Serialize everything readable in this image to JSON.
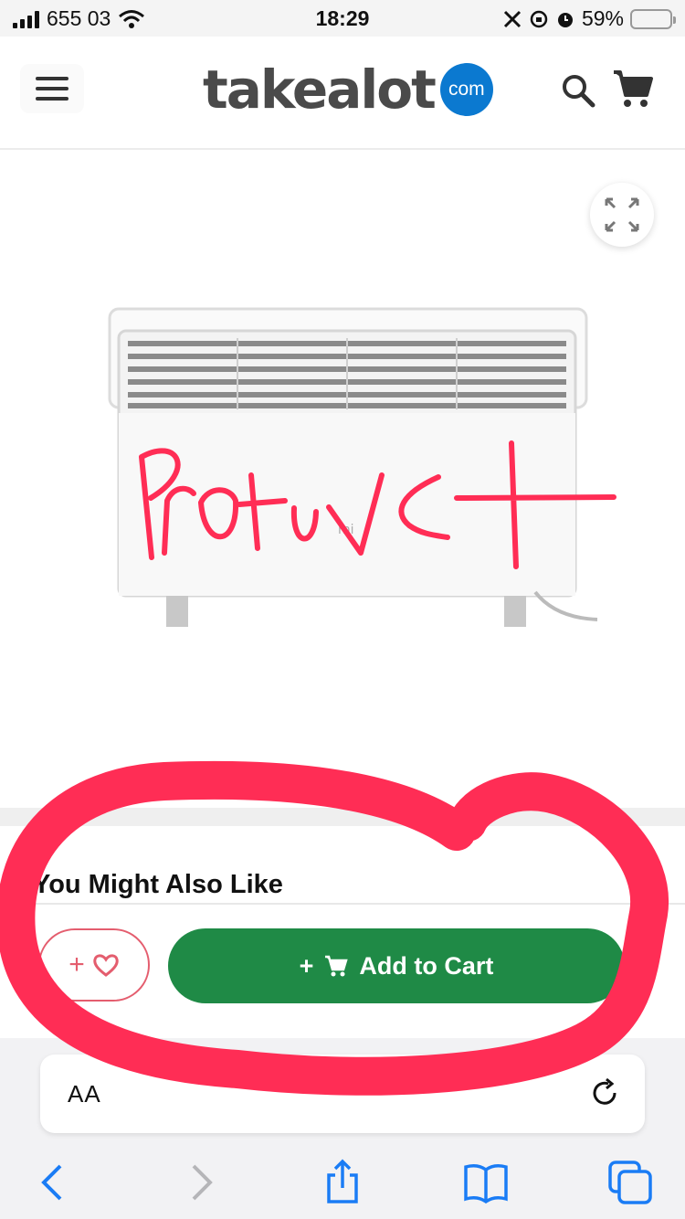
{
  "status_bar": {
    "carrier": "655 03",
    "time": "18:29",
    "battery": "59%",
    "battery_level": 0.59
  },
  "header": {
    "logo_text": "takealot",
    "logo_badge": "com",
    "menu_icon": "hamburger-menu-icon",
    "search_icon": "search-icon",
    "cart_icon": "shopping-cart-icon"
  },
  "product": {
    "expand_icon": "expand-icon",
    "annotation_text": "Protuct"
  },
  "section": {
    "title": "You Might Also Like"
  },
  "actions": {
    "wishlist_plus": "+",
    "wishlist_icon": "heart-icon",
    "cart_plus": "+",
    "cart_label": "Add to Cart",
    "cart_color": "#1f8a46",
    "wishlist_color": "#e45d6e"
  },
  "browser": {
    "aa_label": "AA",
    "reload_icon": "reload-icon",
    "nav_icons": [
      "back-icon",
      "forward-icon",
      "share-icon",
      "bookmarks-icon",
      "tabs-icon"
    ]
  },
  "colors": {
    "annotation": "#ff2d55",
    "brand": "#0b79d0"
  }
}
